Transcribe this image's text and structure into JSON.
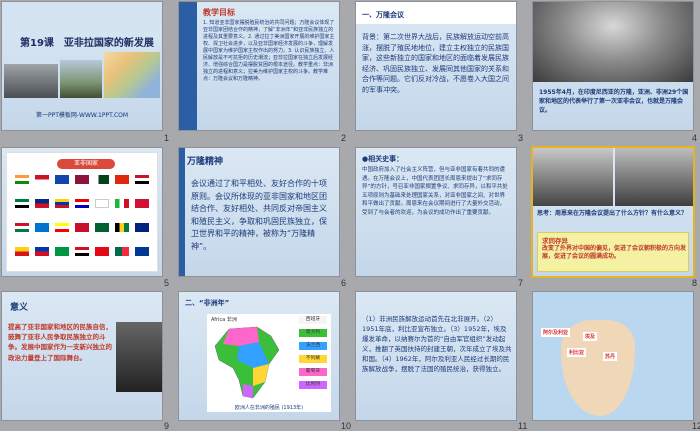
{
  "slides": [
    {
      "number": "1",
      "title": "第19课　亚非拉国家的新发展",
      "footer": "第一PPT模板网-WWW.1PPT.COM"
    },
    {
      "number": "2",
      "title": "教学目标",
      "body": "1. 知道亚非国家摆脱殖民统治的共同问题；万隆会议体现了亚非国家团结合作的精神，了解“非洲年”和亚非民族独立的进程及其重要意义。2. 通过拉丁美洲国家开展的维护国家主权、捍卫社会进步，以及亚非国家经济发展的斗争，理解发展中国家为维护国家主权作出的努力。3. 认识民族独立、人民解放是不可抗拒的历史潮流；亚非拉国家在独立后发展经济、增强综合国力是摆脱贫困的根本途径。教学重点：非洲独立的进程和意义；拉美为维护国家主权的斗争。教学难点：万隆会议和万隆精神。"
    },
    {
      "number": "3",
      "title": "一、万隆会议",
      "body": "背景：第二次世界大战后，民族解放运动空前高涨，摆脱了殖民地地位，建立主权独立的民族国家，这些新独立的国家和地区的面临着发展民族经济、巩固民族独立、发展同其他国家的关系和合作等问题。它们反对冷战，不愿卷入大国之间的军事冲突。"
    },
    {
      "number": "4",
      "caption": "1955年4月，在印度尼西亚的万隆，亚洲、非洲29个国家和地区的代表举行了第一次亚非会议，也就是万隆会议。"
    },
    {
      "number": "5",
      "banner": "亚非国家"
    },
    {
      "number": "6",
      "title": "万隆精神",
      "body": "会议通过了和平相处、友好合作的十项原则。会议所体现的亚非国家和地区团结合作、友好相处、共同反对帝国主义和殖民主义，争取和巩固民族独立，保卫世界和平的精神，被称为“万隆精神”。"
    },
    {
      "number": "7",
      "title": "●相关史事：",
      "body": "中国政府加入了社会主义阵营，但与亚非国家有着共同的遭遇。在万隆会议上，中国代表团团长周恩来提出了“求同存异”的方针，号召亚非国家搁置争议、求同存异，以和平共处五项原则为基础来处理国家关系，对亚非国家之间、对世界和平做出了贡献。周恩来在会议期间进行了大量外交活动，受到了与会者的欢迎，为会议的成功作出了重要贡献。"
    },
    {
      "number": "8",
      "question": "思考：周恩来在万隆会议提出了什么方针？有什么意义？",
      "answer_title": "求同存异",
      "answer": "改变了外界对中国的偏见，促进了会议朝积极的方向发展，促进了会议的圆满成功。"
    },
    {
      "number": "9",
      "title": "意义",
      "body": "提高了亚非国家和地区的民族自信，鼓舞了亚非人民争取民族独立的斗争。发展中国家作为一支新兴独立的政治力量登上了国际舞台。"
    },
    {
      "number": "10",
      "title": "二、“非洲年”",
      "map_title": "Africa 非洲",
      "tags": [
        "西班牙",
        "意大利",
        "法兰西",
        "不列颠",
        "葡萄牙",
        "比利时"
      ],
      "caption": "欧洲人在非洲的殖民 (1913年)"
    },
    {
      "number": "11",
      "body": "（1）非洲民族解放运动首先在北非展开。（2）1951年底，利比亚宣布独立。（3）1952年，埃及爆发革命，以纳赛尔为首的“自由军官组织”发动起义，推翻了英国扶持的封建王朝，次年成立了埃及共和国。（4）1962年，阿尔及利亚人民经过长期的民族解放战争，摆脱了法国的殖民统治，获得独立。"
    },
    {
      "number": "12",
      "labels": [
        "阿尔及利亚",
        "埃及",
        "利比亚",
        "苏丹"
      ]
    }
  ],
  "colors": {
    "background": "#a7a9ac",
    "accent_red": "#c0392b",
    "text_blue": "#1d3b7a",
    "selected": "#e6b321"
  }
}
